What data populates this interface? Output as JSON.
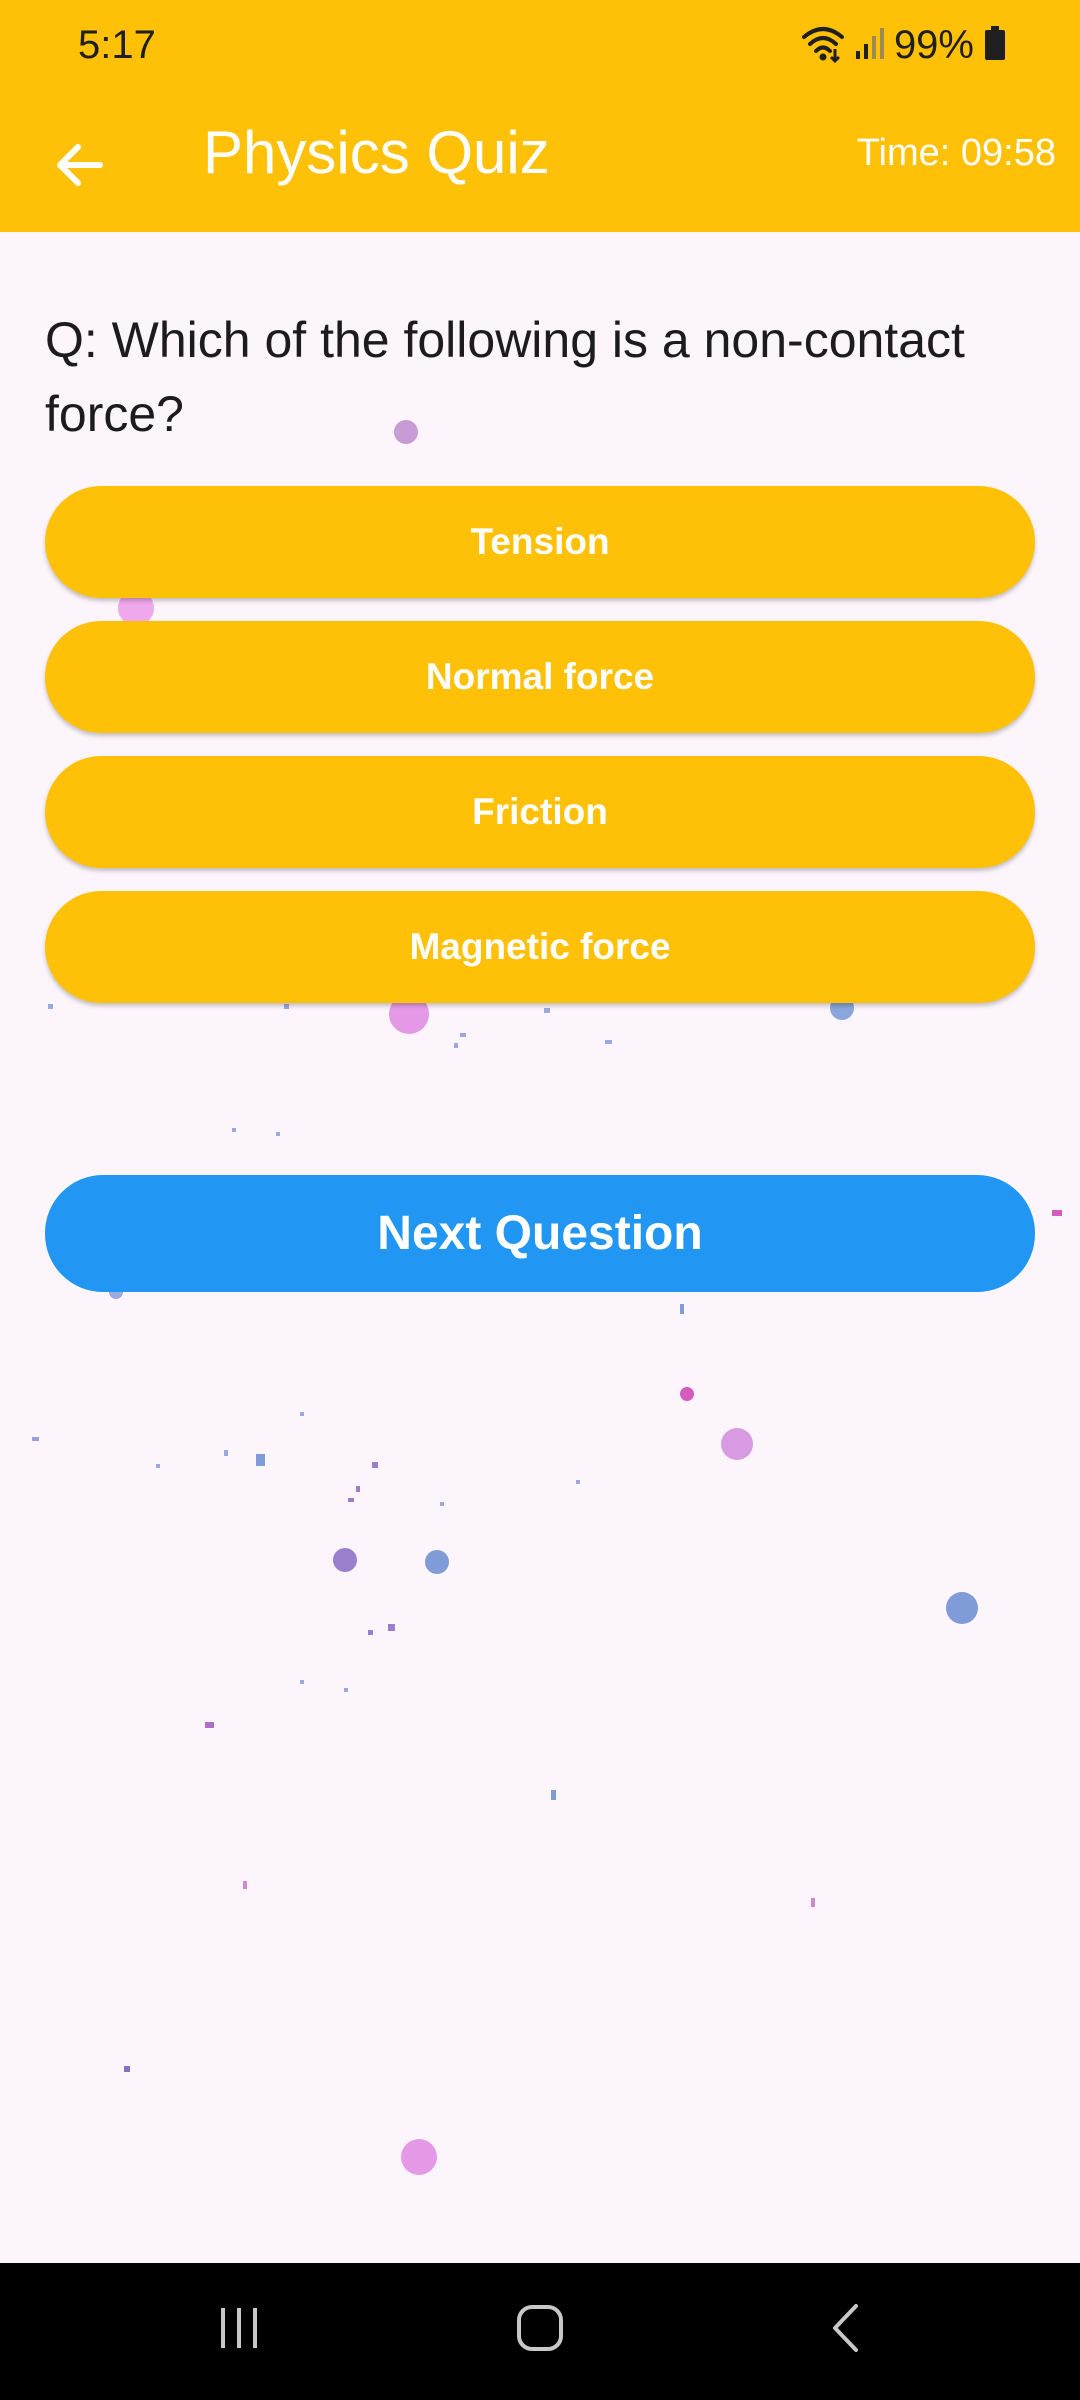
{
  "status_bar": {
    "time": "5:17",
    "battery": "99%",
    "icons": [
      "wifi-icon",
      "signal-icon",
      "battery-icon"
    ]
  },
  "app_bar": {
    "title": "Physics Quiz",
    "timer": "Time: 09:58",
    "back_icon": "arrow-back-icon"
  },
  "question": {
    "text": "Q: Which of the following is a non-contact force?"
  },
  "options": [
    {
      "label": "Tension"
    },
    {
      "label": "Normal force"
    },
    {
      "label": "Friction"
    },
    {
      "label": "Magnetic force"
    }
  ],
  "next_button": {
    "label": "Next Question"
  },
  "nav_bar": {
    "icons": [
      "recent-apps-icon",
      "home-icon",
      "back-nav-icon"
    ]
  },
  "colors": {
    "primary": "#ffc107",
    "accent": "#2196f3",
    "background": "#fcf5fb",
    "text": "#1d1b20",
    "particle_pink": "#e8a2e8",
    "particle_purple": "#9a7fcf",
    "particle_blue": "#7f9bd8"
  }
}
